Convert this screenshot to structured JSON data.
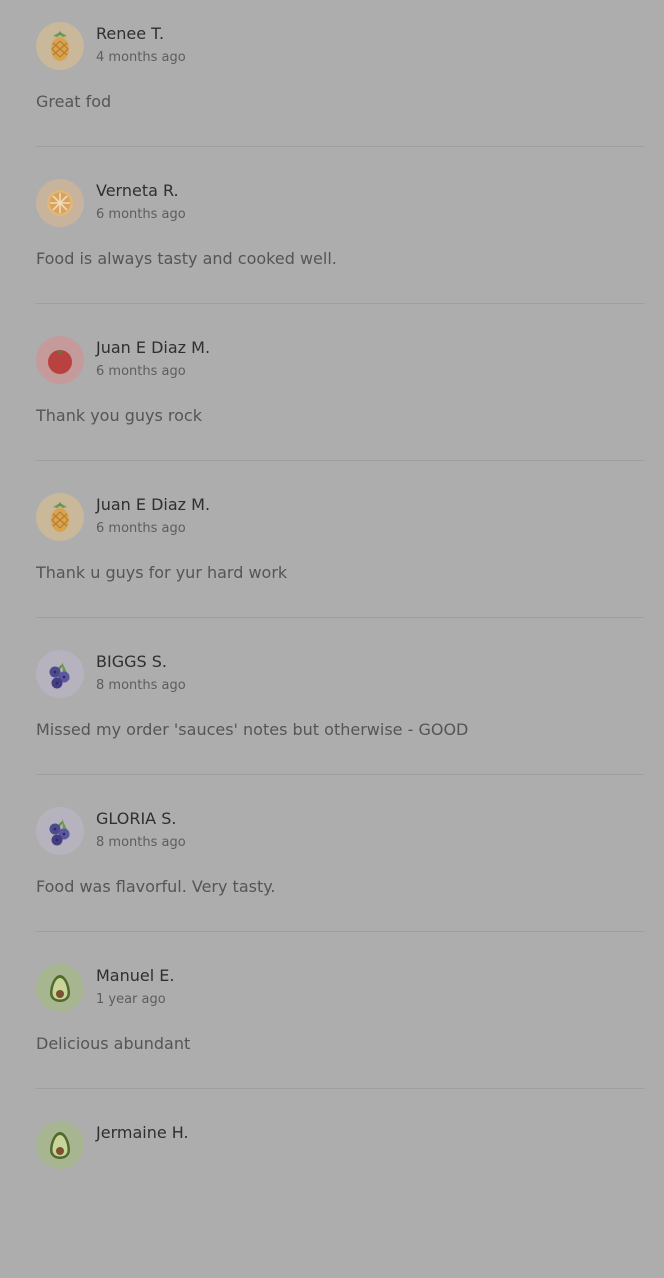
{
  "reviews": [
    {
      "name": "Renee T.",
      "time": "4 months ago",
      "text": "Great fod",
      "avatar": "pineapple-icon"
    },
    {
      "name": "Verneta R.",
      "time": "6 months ago",
      "text": "Food is always tasty and cooked well.",
      "avatar": "orange-slice-icon"
    },
    {
      "name": "Juan E Diaz M.",
      "time": "6 months ago",
      "text": "Thank you guys rock",
      "avatar": "tomato-icon"
    },
    {
      "name": "Juan E Diaz M.",
      "time": "6 months ago",
      "text": "Thank u guys for yur hard work",
      "avatar": "pineapple-icon"
    },
    {
      "name": "BIGGS S.",
      "time": "8 months ago",
      "text": "Missed my order 'sauces' notes but otherwise - GOOD",
      "avatar": "blueberries-icon"
    },
    {
      "name": "GLORIA S.",
      "time": "8 months ago",
      "text": "Food was flavorful. Very tasty.",
      "avatar": "blueberries-icon"
    },
    {
      "name": "Manuel E.",
      "time": "1 year ago",
      "text": "Delicious abundant",
      "avatar": "avocado-icon"
    },
    {
      "name": "Jermaine H.",
      "time": "",
      "text": "",
      "avatar": "avocado-icon"
    }
  ]
}
